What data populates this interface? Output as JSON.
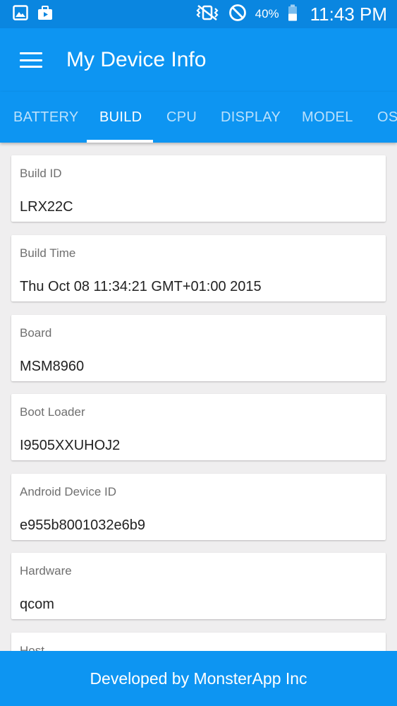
{
  "status_bar": {
    "battery_percent": "40%",
    "time": "11:43 PM",
    "icons": [
      "gallery-icon",
      "media-icon",
      "vibrate-icon",
      "block-icon",
      "battery-icon"
    ]
  },
  "app_bar": {
    "title": "My Device Info",
    "menu_icon": "hamburger-menu-icon"
  },
  "tabs": [
    {
      "label": "BATTERY",
      "active": false
    },
    {
      "label": "BUILD",
      "active": true
    },
    {
      "label": "CPU",
      "active": false
    },
    {
      "label": "DISPLAY",
      "active": false
    },
    {
      "label": "MODEL",
      "active": false
    },
    {
      "label": "OS",
      "active": false
    }
  ],
  "cards": [
    {
      "label": "Build ID",
      "value": "LRX22C"
    },
    {
      "label": "Build Time",
      "value": "Thu Oct 08 11:34:21 GMT+01:00 2015"
    },
    {
      "label": "Board",
      "value": "MSM8960"
    },
    {
      "label": "Boot Loader",
      "value": "I9505XXUHOJ2"
    },
    {
      "label": "Android Device ID",
      "value": "e955b8001032e6b9"
    },
    {
      "label": "Hardware",
      "value": "qcom"
    },
    {
      "label": "Host",
      "value": ""
    }
  ],
  "footer": {
    "text": "Developed by MonsterApp Inc"
  },
  "colors": {
    "primary": "#0d95f2",
    "status_bar": "#0a86e0",
    "background": "#efeeef"
  }
}
